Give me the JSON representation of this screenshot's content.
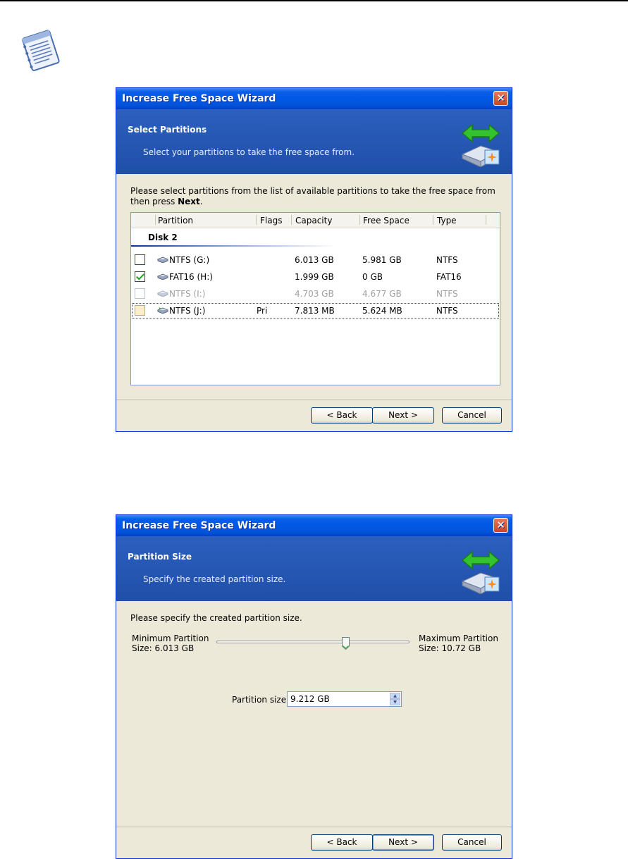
{
  "wizard1": {
    "title": "Increase Free Space Wizard",
    "close_glyph": "✕",
    "header_title": "Select Partitions",
    "header_subtitle": "Select your partitions to take the free space from.",
    "instruction_text": "Please select partitions from the list of available partitions to take the free space from then press ",
    "instruction_bold": "Next",
    "instruction_end": ".",
    "columns": [
      "Partition",
      "Flags",
      "Capacity",
      "Free Space",
      "Type"
    ],
    "disk_label": "Disk 2",
    "rows": [
      {
        "partition": "NTFS (G:)",
        "flags": "",
        "capacity": "6.013 GB",
        "free": "5.981 GB",
        "type": "NTFS",
        "checked": false,
        "disabled": false
      },
      {
        "partition": "FAT16 (H:)",
        "flags": "",
        "capacity": "1.999 GB",
        "free": "0 GB",
        "type": "FAT16",
        "checked": true,
        "disabled": false
      },
      {
        "partition": "NTFS (I:)",
        "flags": "",
        "capacity": "4.703 GB",
        "free": "4.677 GB",
        "type": "NTFS",
        "checked": false,
        "disabled": true
      },
      {
        "partition": "NTFS (J:)",
        "flags": "Pri",
        "capacity": "7.813 MB",
        "free": "5.624 MB",
        "type": "NTFS",
        "checked": false,
        "disabled": false
      }
    ],
    "back_label": "< Back",
    "next_label": "Next >",
    "cancel_label": "Cancel"
  },
  "wizard2": {
    "title": "Increase Free Space Wizard",
    "close_glyph": "✕",
    "header_title": "Partition Size",
    "header_subtitle": "Specify the created partition size.",
    "instruction_text": "Please specify the created partition size.",
    "min_label_line1": "Minimum Partition",
    "min_label_line2": "Size: 6.013 GB",
    "max_label_line1": "Maximum Partition",
    "max_label_line2": "Size: 10.72 GB",
    "slider_fraction": 0.68,
    "size_label": "Partition size:",
    "size_value": "9.212 GB",
    "back_label": "< Back",
    "next_label": "Next >",
    "cancel_label": "Cancel"
  },
  "colors": {
    "accent": "#0058e6",
    "header_blue": "#2c5fbf",
    "dialog_bg": "#ece9d8",
    "check_green": "#21a121"
  },
  "icons": {
    "note": "notepad-icon",
    "header": "disk-transfer-icon",
    "disk": "hard-disk-icon"
  }
}
